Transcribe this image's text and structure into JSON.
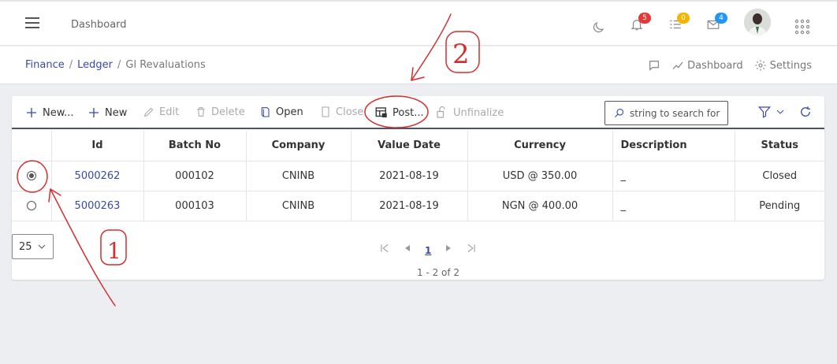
{
  "topbar": {
    "title": "Dashboard",
    "badges": {
      "notifications": "5",
      "tasks": "0",
      "messages": "4"
    },
    "colors": {
      "notifications": "#e53935",
      "tasks": "#f6b400",
      "messages": "#2196f3"
    }
  },
  "breadcrumb": {
    "items": [
      "Finance",
      "Ledger"
    ],
    "current": "Gl Revaluations",
    "right": {
      "dashboard": "Dashboard",
      "settings": "Settings"
    }
  },
  "toolbar": {
    "new_menu": "New...",
    "new": "New",
    "edit": "Edit",
    "delete": "Delete",
    "open": "Open",
    "close": "Close",
    "post": "Post...",
    "unfinalize": "Unfinalize",
    "search_placeholder": "string to search for"
  },
  "table": {
    "headers": [
      "Id",
      "Batch No",
      "Company",
      "Value Date",
      "Currency",
      "Description",
      "Status"
    ],
    "rows": [
      {
        "selected": true,
        "id": "5000262",
        "batch": "000102",
        "company": "CNINB",
        "date": "2021-08-19",
        "currency": "USD @ 350.00",
        "description": "_",
        "status": "Closed"
      },
      {
        "selected": false,
        "id": "5000263",
        "batch": "000103",
        "company": "CNINB",
        "date": "2021-08-19",
        "currency": "NGN @ 400.00",
        "description": "_",
        "status": "Pending"
      }
    ]
  },
  "pager": {
    "page_size": "25",
    "current_page": "1",
    "info": "1 - 2 of 2"
  },
  "annotations": {
    "one": "1",
    "two": "2",
    "color": "#d32f2f"
  },
  "accent": "#3949ab"
}
